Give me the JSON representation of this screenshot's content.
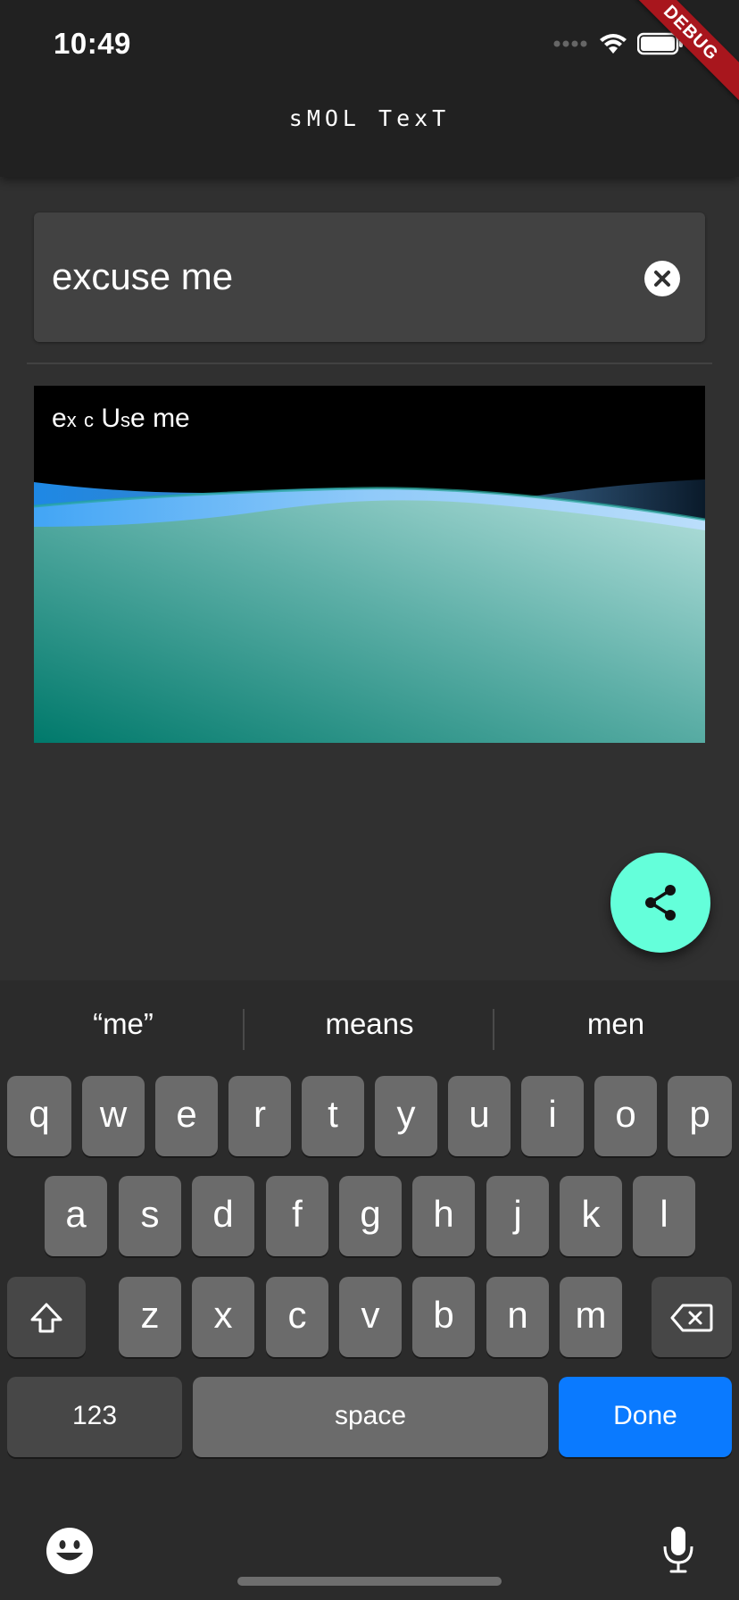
{
  "status_bar": {
    "time": "10:49"
  },
  "debug_banner": "DEBUG",
  "app_bar": {
    "title": "sMOL TexT"
  },
  "text_field": {
    "value": "excuse me"
  },
  "preview": {
    "text_parts": [
      "e",
      "x",
      " ",
      "c",
      " ",
      "U",
      "s",
      "e me"
    ]
  },
  "suggestions": [
    "“me”",
    "means",
    "men"
  ],
  "keyboard": {
    "row1": [
      "q",
      "w",
      "e",
      "r",
      "t",
      "y",
      "u",
      "i",
      "o",
      "p"
    ],
    "row2": [
      "a",
      "s",
      "d",
      "f",
      "g",
      "h",
      "j",
      "k",
      "l"
    ],
    "row3": [
      "z",
      "x",
      "c",
      "v",
      "b",
      "n",
      "m"
    ],
    "numbers_label": "123",
    "space_label": "space",
    "done_label": "Done"
  },
  "colors": {
    "fab": "#64ffda",
    "done_key": "#0a7aff",
    "debug_banner": "#a8161d"
  },
  "icons": [
    "wifi-icon",
    "battery-icon",
    "clear-icon",
    "share-icon",
    "shift-icon",
    "backspace-icon",
    "emoji-icon",
    "microphone-icon"
  ]
}
